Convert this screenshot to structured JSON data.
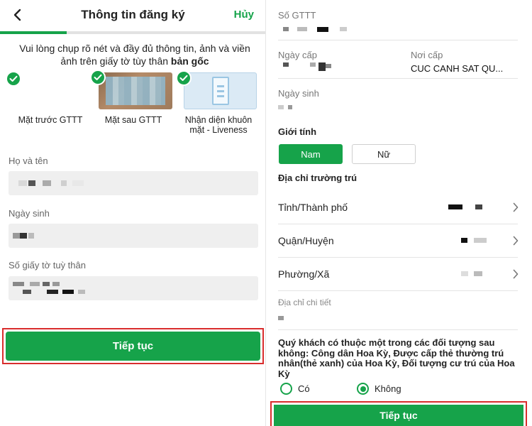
{
  "left": {
    "header": {
      "title": "Thông tin đăng ký",
      "cancel_label": "Hủy",
      "back_icon": "chevron-left-icon"
    },
    "progress": {
      "value": 0.25
    },
    "instruction": {
      "text": "Vui lòng chụp rõ nét và đầy đủ thông tin, ảnh và viền ảnh trên giấy tờ tùy thân ",
      "bold": "bản gốc"
    },
    "documents": [
      {
        "label": "Mặt trước GTTT",
        "checked": true
      },
      {
        "label": "Mặt sau GTTT",
        "checked": true
      },
      {
        "label": "Nhận diện khuôn mặt - Liveness",
        "checked": true
      }
    ],
    "fields": [
      {
        "label": "Họ và tên"
      },
      {
        "label": "Ngày sinh"
      },
      {
        "label": "Số giấy tờ tuỳ thân"
      }
    ],
    "continue_label": "Tiếp tục"
  },
  "right": {
    "id_number_label": "Số GTTT",
    "issue_date_label": "Ngày cấp",
    "issue_place_label": "Nơi cấp",
    "issue_place_value": "CUC CANH SAT QU...",
    "dob_label": "Ngày sinh",
    "gender": {
      "title": "Giới tính",
      "options": [
        "Nam",
        "Nữ"
      ],
      "selected": "Nam"
    },
    "address": {
      "title": "Địa chỉ trường trú",
      "rows": [
        "Tỉnh/Thành phố",
        "Quận/Huyện",
        "Phường/Xã"
      ],
      "detail_label": "Địa chỉ chi tiết"
    },
    "question": "Quý khách có thuộc một trong các đối tượng sau không: Công dân Hoa Kỳ, Được cấp thẻ thường trú nhân(thẻ xanh) của Hoa Kỳ, Đối tượng cư trú của Hoa Kỳ",
    "answer_options": [
      "Có",
      "Không"
    ],
    "answer_selected": "Không",
    "continue_label": "Tiếp tục"
  },
  "colors": {
    "accent": "#16a34a",
    "highlight_border": "#d92d2d",
    "field_bg": "#efefef"
  }
}
